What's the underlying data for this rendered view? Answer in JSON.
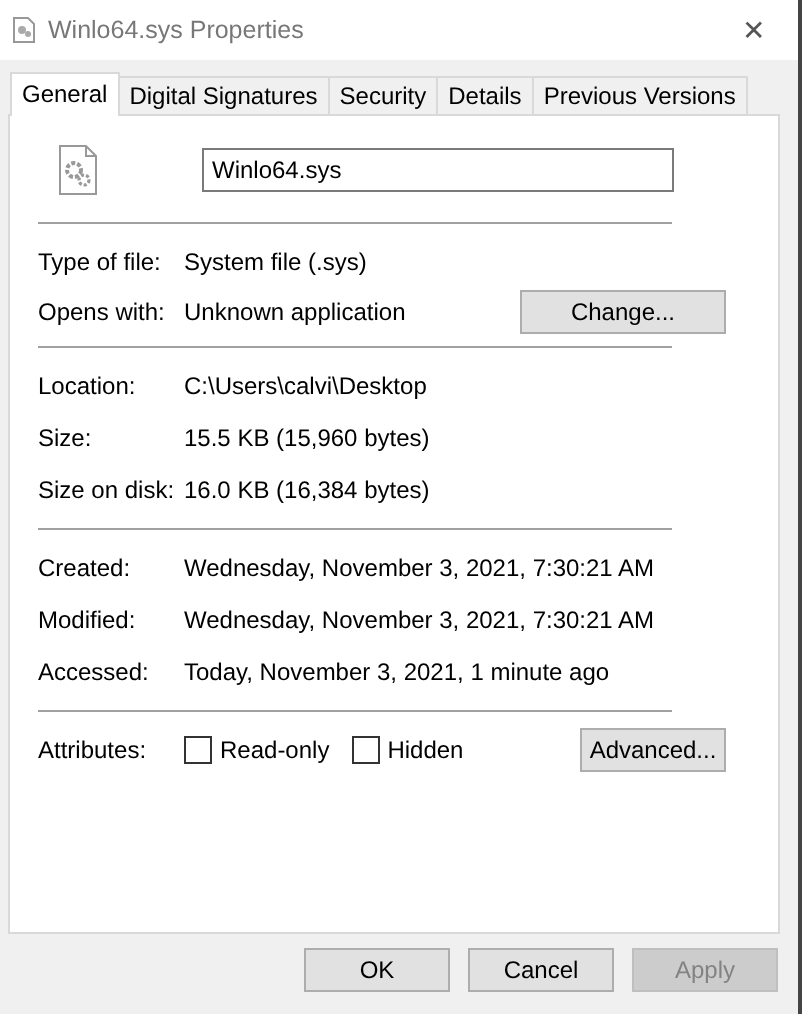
{
  "window": {
    "title": "Winlo64.sys Properties",
    "close": "✕"
  },
  "tabs": [
    {
      "label": "General",
      "selected": true
    },
    {
      "label": "Digital Signatures",
      "selected": false
    },
    {
      "label": "Security",
      "selected": false
    },
    {
      "label": "Details",
      "selected": false
    },
    {
      "label": "Previous Versions",
      "selected": false
    }
  ],
  "file_name": "Winlo64.sys",
  "sections": [
    [
      {
        "label": "Type of file:",
        "value": "System file (.sys)"
      },
      {
        "label": "Opens with:",
        "value": "Unknown application",
        "button": "Change..."
      }
    ],
    [
      {
        "label": "Location:",
        "value": "C:\\Users\\calvi\\Desktop"
      },
      {
        "label": "Size:",
        "value": "15.5 KB (15,960 bytes)"
      },
      {
        "label": "Size on disk:",
        "value": "16.0 KB (16,384 bytes)"
      }
    ],
    [
      {
        "label": "Created:",
        "value": "Wednesday, November 3, 2021, 7:30:21 AM"
      },
      {
        "label": "Modified:",
        "value": "Wednesday, November 3, 2021, 7:30:21 AM"
      },
      {
        "label": "Accessed:",
        "value": "Today, November 3, 2021, 1 minute ago"
      }
    ]
  ],
  "attributes": {
    "label": "Attributes:",
    "checkboxes": [
      {
        "label": "Read-only",
        "checked": false
      },
      {
        "label": "Hidden",
        "checked": false
      }
    ],
    "button": "Advanced..."
  },
  "buttons": [
    {
      "label": "OK",
      "disabled": false
    },
    {
      "label": "Cancel",
      "disabled": false
    },
    {
      "label": "Apply",
      "disabled": true
    }
  ]
}
